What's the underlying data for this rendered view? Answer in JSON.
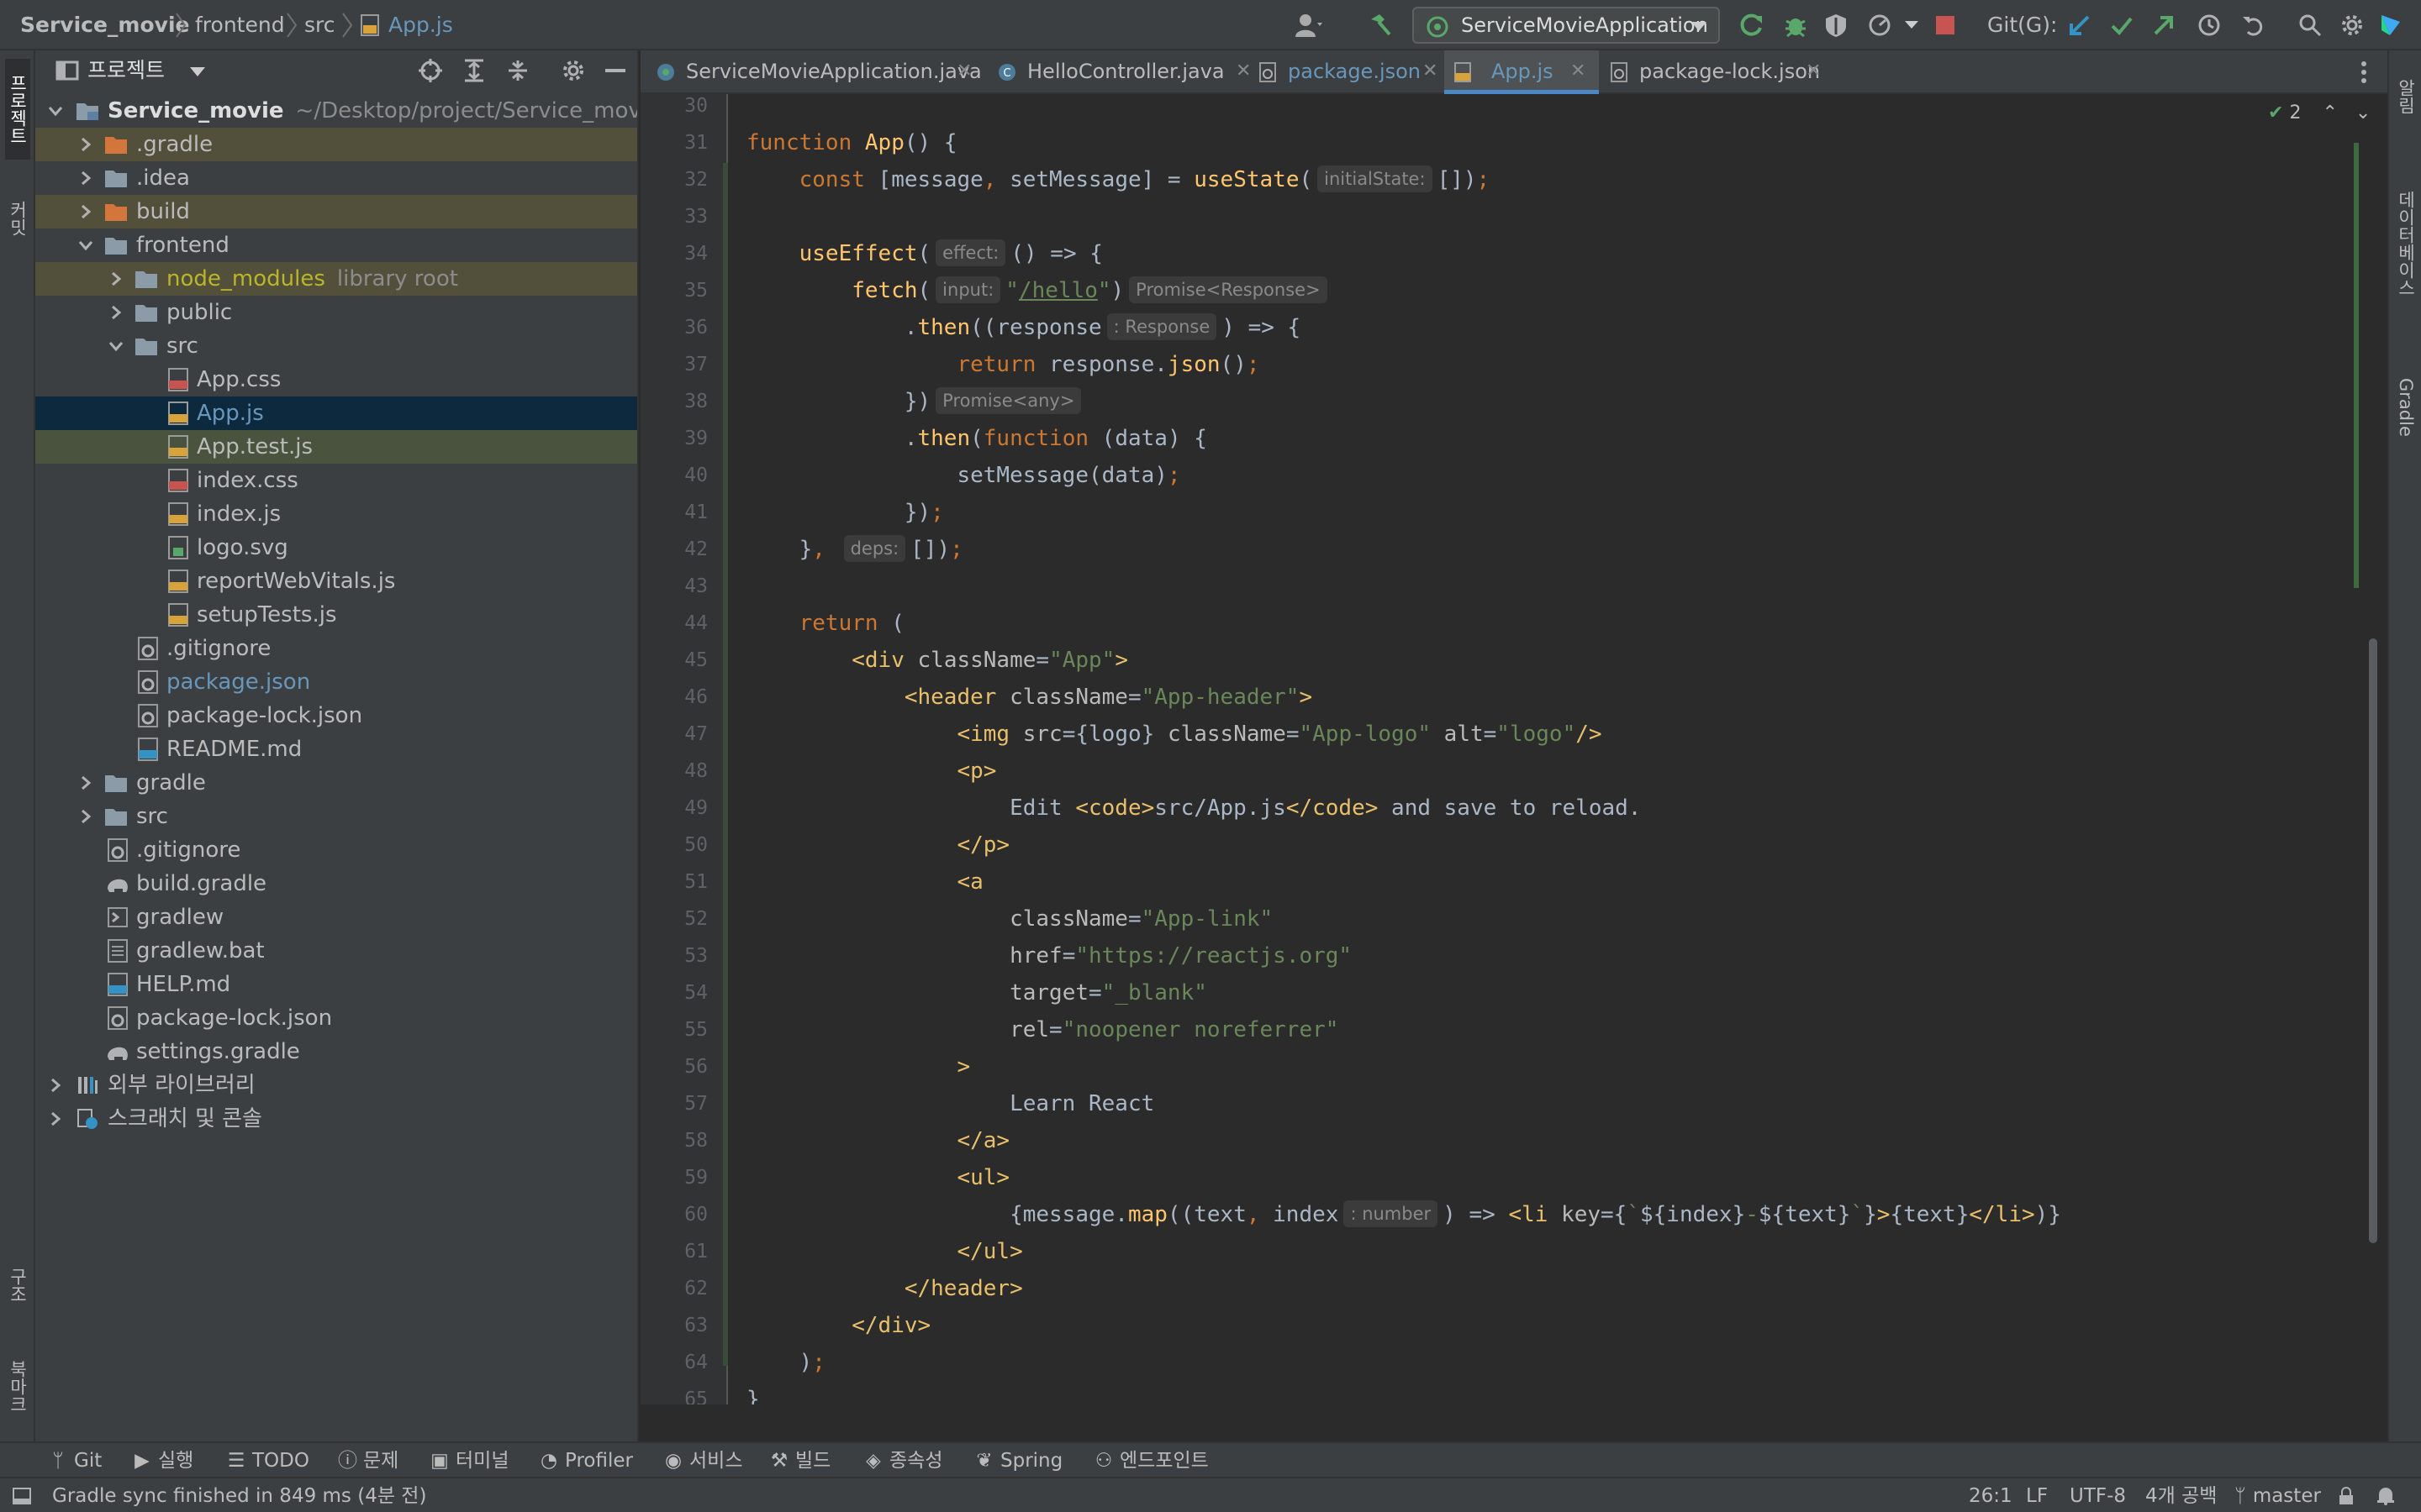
{
  "breadcrumb": {
    "project": "Service_movie",
    "folder1": "frontend",
    "folder2": "src",
    "file": "App.js"
  },
  "toolbar_top": {
    "run_config": "ServiceMovieApplication",
    "git_label": "Git(G):"
  },
  "left_strip": {
    "project_tab": "프로젝트",
    "commit_tab": "커밋",
    "structure_tab": "구조",
    "bookmarks_tab": "북마크"
  },
  "right_strip": {
    "notifications_tab": "알림",
    "database_tab": "데이터베이스",
    "gradle_tab": "Gradle"
  },
  "project_panel": {
    "title": "프로젝트",
    "root_name": "Service_movie",
    "root_path": "~/Desktop/project/Service_movie",
    "items": [
      {
        "label": ".gradle"
      },
      {
        "label": ".idea"
      },
      {
        "label": "build"
      },
      {
        "label": "frontend"
      },
      {
        "label": "node_modules",
        "note": "library root"
      },
      {
        "label": "public"
      },
      {
        "label": "src"
      },
      {
        "label": "App.css"
      },
      {
        "label": "App.js"
      },
      {
        "label": "App.test.js"
      },
      {
        "label": "index.css"
      },
      {
        "label": "index.js"
      },
      {
        "label": "logo.svg"
      },
      {
        "label": "reportWebVitals.js"
      },
      {
        "label": "setupTests.js"
      },
      {
        "label": ".gitignore"
      },
      {
        "label": "package.json"
      },
      {
        "label": "package-lock.json"
      },
      {
        "label": "README.md"
      },
      {
        "label": "gradle"
      },
      {
        "label": "src"
      },
      {
        "label": ".gitignore"
      },
      {
        "label": "build.gradle"
      },
      {
        "label": "gradlew"
      },
      {
        "label": "gradlew.bat"
      },
      {
        "label": "HELP.md"
      },
      {
        "label": "package-lock.json"
      },
      {
        "label": "settings.gradle"
      },
      {
        "label": "외부 라이브러리"
      },
      {
        "label": "스크래치 및 콘솔"
      }
    ]
  },
  "editor_tabs": [
    {
      "label": "ServiceMovieApplication.java"
    },
    {
      "label": "HelloController.java"
    },
    {
      "label": "package.json"
    },
    {
      "label": "App.js"
    },
    {
      "label": "package-lock.json"
    }
  ],
  "editor": {
    "inspection_count": "2",
    "line_numbers": [
      "30",
      "31",
      "32",
      "33",
      "34",
      "35",
      "36",
      "37",
      "38",
      "39",
      "40",
      "41",
      "42",
      "43",
      "44",
      "45",
      "46",
      "47",
      "48",
      "49",
      "50",
      "51",
      "52",
      "53",
      "54",
      "55",
      "56",
      "57",
      "58",
      "59",
      "60",
      "61",
      "62",
      "63",
      "64",
      "65"
    ],
    "hints": {
      "initial_state": "initialState:",
      "effect": "effect:",
      "input": "input:",
      "promise_response": "Promise<Response>",
      "response_type": ": Response",
      "promise_any": "Promise<any>",
      "deps": "deps:",
      "number_type": ": number"
    }
  },
  "tool_windows": [
    {
      "label": "Git"
    },
    {
      "label": "실행"
    },
    {
      "label": "TODO"
    },
    {
      "label": "문제"
    },
    {
      "label": "터미널"
    },
    {
      "label": "Profiler"
    },
    {
      "label": "서비스"
    },
    {
      "label": "빌드"
    },
    {
      "label": "종속성"
    },
    {
      "label": "Spring"
    },
    {
      "label": "엔드포인트"
    }
  ],
  "status_bar": {
    "message": "Gradle sync finished in 849 ms (4분 전)",
    "position": "26:1",
    "line_sep": "LF",
    "encoding": "UTF-8",
    "indent": "4개 공백",
    "branch": "master"
  },
  "colors": {
    "accent": "#4a88c7",
    "keyword": "#cc7832",
    "function": "#ffc66d",
    "string": "#6a8759",
    "tag": "#e8bf6a",
    "run_green": "#59a869",
    "stop_red": "#c75450"
  }
}
